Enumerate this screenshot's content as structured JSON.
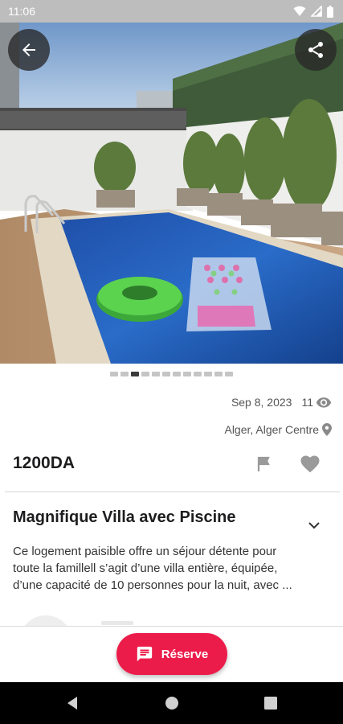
{
  "status_bar": {
    "time": "11:06",
    "icons": [
      "wifi-icon",
      "signal-icon",
      "battery-icon"
    ]
  },
  "hero": {
    "image": "pool-villa-photo",
    "slide_count": 12,
    "active_slide": 3
  },
  "listing": {
    "date": "Sep 8, 2023",
    "views": "11",
    "location": "Alger, Alger Centre",
    "price": "1200DA",
    "title": "Magnifique Villa avec Piscine",
    "description_lines": [
      "Ce logement paisible offre un séjour détente pour",
      "toute la famillell s’agit d’une villa entière, équipée,",
      "d’une capacité de 10 personnes pour la nuit, avec ..."
    ]
  },
  "actions": {
    "reserve_label": "Réserve"
  },
  "colors": {
    "accent": "#ec1c4a",
    "icon_gray": "#9a9a9a",
    "status_bar": "#bdbdbd"
  }
}
